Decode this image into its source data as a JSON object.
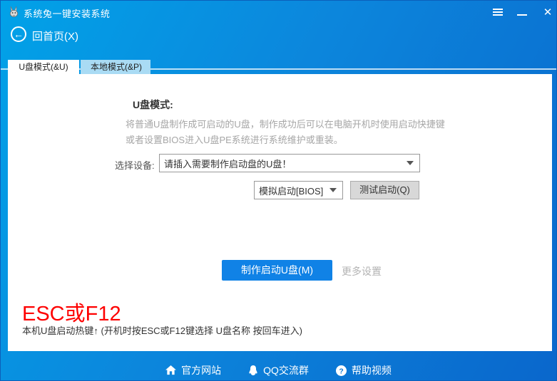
{
  "window": {
    "title": "系统兔一键安装系统"
  },
  "icons": {
    "back_arrow": "←",
    "close": "✕"
  },
  "header": {
    "back_label": "回首页(X)"
  },
  "tabs": [
    {
      "label": "U盘模式(&U)",
      "active": true
    },
    {
      "label": "本地模式(&P)",
      "active": false
    }
  ],
  "content": {
    "heading": "U盘模式:",
    "description_line1": "将普通U盘制作成可启动的U盘，制作成功后可以在电脑开机时使用启动快捷键",
    "description_line2": "或者设置BIOS进入U盘PE系统进行系统维护或重装。",
    "device_label": "选择设备:",
    "device_select_value": "请插入需要制作启动盘的U盘！",
    "boot_mode_value": "模拟启动[BIOS]",
    "test_button_label": "测试启动(Q)",
    "make_button_label": "制作启动U盘(M)",
    "more_settings_label": "更多设置",
    "hotkey": "ESC或F12",
    "hotkey_note": "本机U盘启动热键↑ (开机时按ESC或F12键选择 U盘名称 按回车进入)"
  },
  "footer": {
    "links": [
      {
        "label": "官方网站"
      },
      {
        "label": "QQ交流群"
      },
      {
        "label": "帮助视频"
      }
    ]
  },
  "colors": {
    "titlebar_gradient_start": "#01a2e8",
    "titlebar_gradient_end": "#0a67cc",
    "accent_button": "#1082e6",
    "inactive_tab_bg": "#a9dbf4",
    "hotkey_red": "#fe0000",
    "panel_bg": "#ffffff"
  }
}
